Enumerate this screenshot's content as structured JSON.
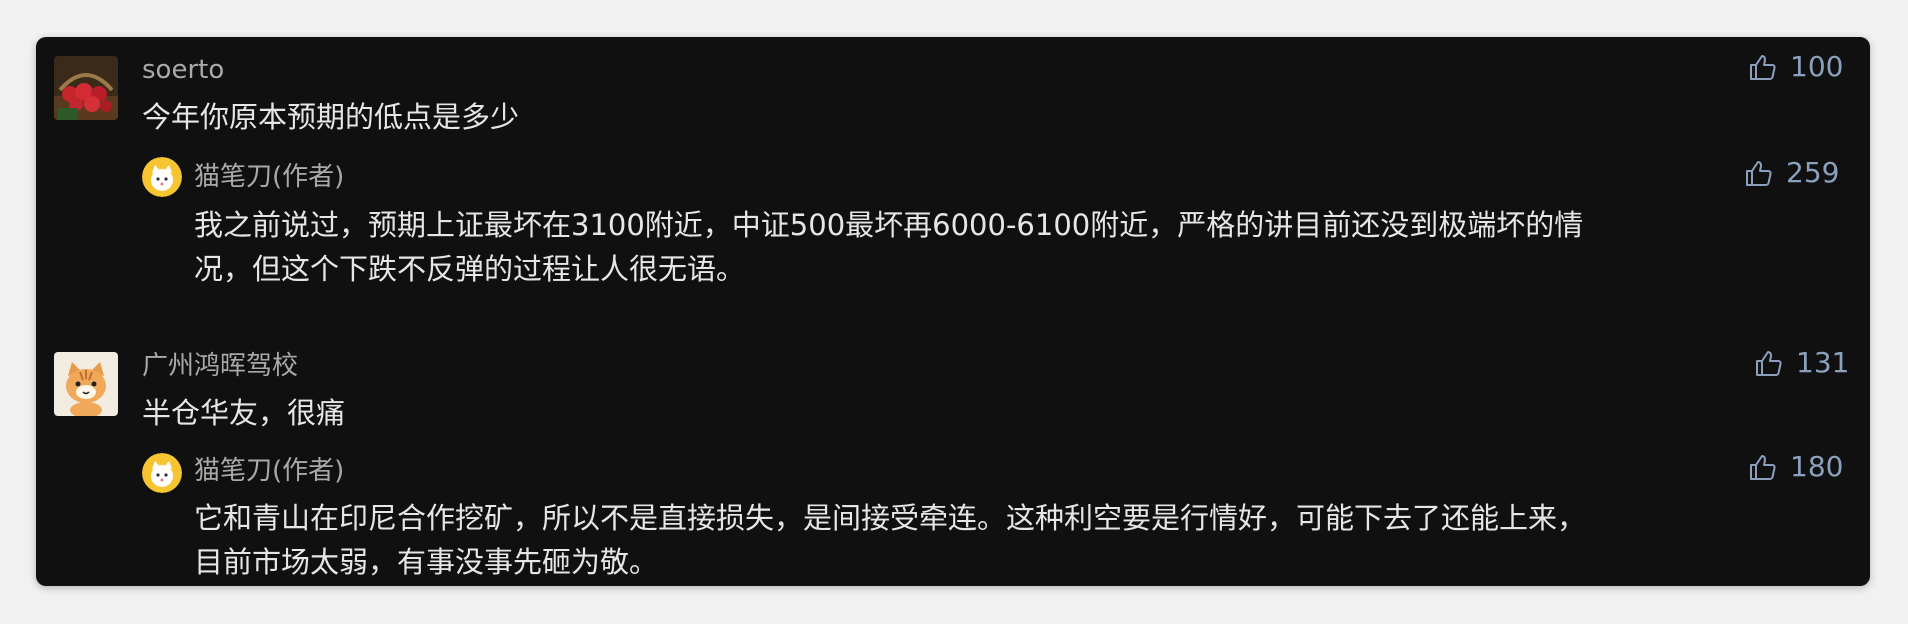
{
  "comments": [
    {
      "author": "soerto",
      "text": "今年你原本预期的低点是多少",
      "likes": "100",
      "avatar_icon": "strawberry-basket-avatar",
      "reply": {
        "author": "猫笔刀(作者)",
        "lines": [
          "我之前说过，预期上证最坏在3100附近，中证500最坏再6000-6100附近，严格的讲目前还没到极端坏的情",
          "况，但这个下跌不反弹的过程让人很无语。"
        ],
        "likes": "259",
        "avatar_icon": "cartoon-cat-avatar"
      }
    },
    {
      "author": "广州鸿晖驾校",
      "text": "半仓华友，很痛",
      "likes": "131",
      "avatar_icon": "orange-cat-avatar",
      "reply": {
        "author": "猫笔刀(作者)",
        "lines": [
          "它和青山在印尼合作挖矿，所以不是直接损失，是间接受牵连。这种利空要是行情好，可能下去了还能上来，",
          "目前市场太弱，有事没事先砸为敬。"
        ],
        "likes": "180",
        "avatar_icon": "cartoon-cat-avatar"
      }
    }
  ],
  "colors": {
    "background": "#101010",
    "name": "#a9a9a9",
    "text": "#e6e6e6",
    "like": "#8aa0bd"
  }
}
